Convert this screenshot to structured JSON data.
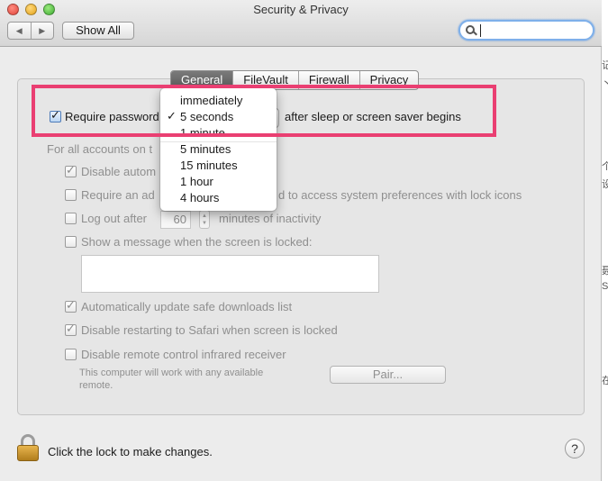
{
  "window": {
    "title": "Security & Privacy"
  },
  "toolbar": {
    "back_glyph": "◀",
    "forward_glyph": "▶",
    "show_all": "Show All",
    "search_placeholder": ""
  },
  "tabs": [
    {
      "label": "General",
      "selected": true
    },
    {
      "label": "FileVault",
      "selected": false
    },
    {
      "label": "Firewall",
      "selected": false
    },
    {
      "label": "Privacy",
      "selected": false
    }
  ],
  "general": {
    "require_password_label": "Require password",
    "require_password_checked": true,
    "after_sleep_text": "after sleep or screen saver begins",
    "for_all_accounts": "For all accounts on t",
    "options": {
      "disable_auto_login": {
        "label": "Disable autom",
        "checked": true
      },
      "require_admin": {
        "label": "Require an ad",
        "suffix": "d to access system preferences with lock icons",
        "checked": false
      },
      "logout_after": {
        "label": "Log out after",
        "value": "60",
        "suffix": "minutes of inactivity",
        "checked": false
      },
      "show_message": {
        "label": "Show a message when the screen is locked:",
        "checked": false
      },
      "auto_update": {
        "label": "Automatically update safe downloads list",
        "checked": true
      },
      "disable_restart_safari": {
        "label": "Disable restarting to Safari when screen is locked",
        "checked": true
      },
      "disable_ir": {
        "label": "Disable remote control infrared receiver",
        "checked": false
      }
    },
    "ir_note": "This computer will work with any available remote.",
    "pair_button": "Pair..."
  },
  "dropdown": {
    "check_glyph": "✓",
    "items": [
      "immediately",
      "5 seconds",
      "1 minute",
      "5 minutes",
      "15 minutes",
      "1 hour",
      "4 hours"
    ],
    "selected": "5 seconds"
  },
  "footer": {
    "lock_text": "Click the lock to make changes.",
    "help": "?"
  },
  "side_glyphs": [
    "记",
    "⼂",
    "个",
    "设",
    "聂",
    "S",
    "在"
  ],
  "colors": {
    "highlight": "#ea3f72",
    "search_focus": "#7fb0ea"
  }
}
